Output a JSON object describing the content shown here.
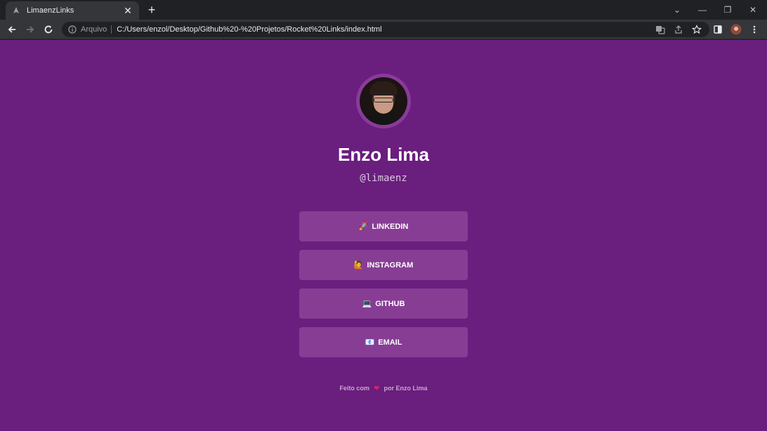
{
  "browser": {
    "tab_title": "LimaenzLinks",
    "tab_close": "✕",
    "new_tab": "+",
    "window_controls": {
      "dropdown": "⌄",
      "minimize": "—",
      "restore": "❐",
      "close": "✕"
    },
    "omnibox": {
      "scheme_label": "Arquivo",
      "url": "C:/Users/enzol/Desktop/Github%20-%20Projetos/Rocket%20Links/index.html"
    }
  },
  "profile": {
    "name": "Enzo Lima",
    "handle": "@limaenz"
  },
  "links": [
    {
      "emoji": "🚀",
      "label": "LINKEDIN"
    },
    {
      "emoji": "🙋",
      "label": "INSTAGRAM"
    },
    {
      "emoji": "💻",
      "label": "GITHUB"
    },
    {
      "emoji": "📧",
      "label": "EMAIL"
    }
  ],
  "footer": {
    "prefix": "Feito com",
    "heart": "❤",
    "suffix": "por Enzo Lima"
  },
  "colors": {
    "page_bg": "#6a1e7e",
    "button_bg": "#873d94",
    "heart": "#e0245e"
  }
}
